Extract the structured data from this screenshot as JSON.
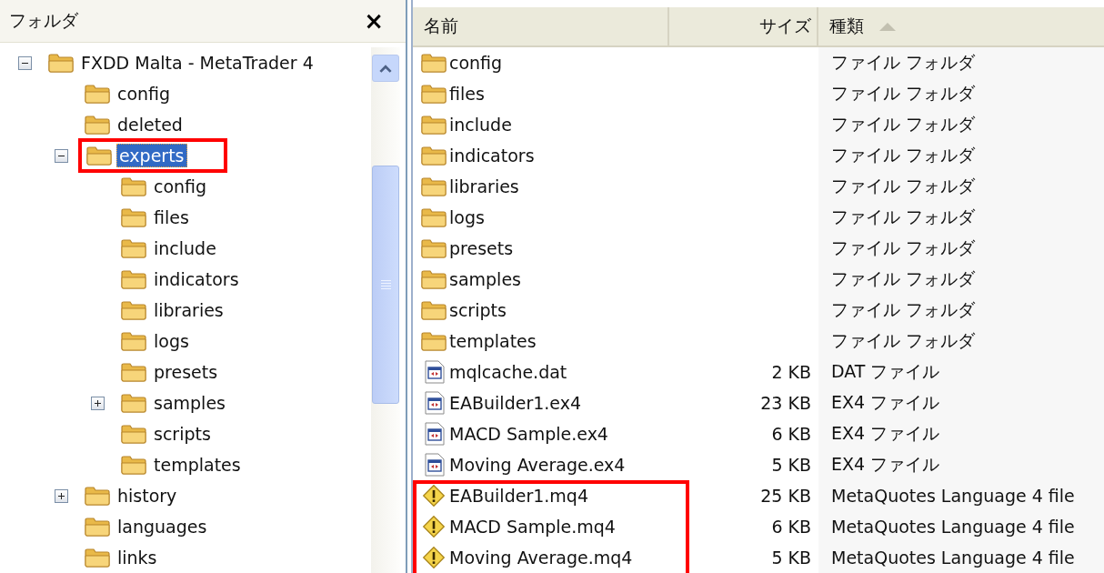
{
  "folder_pane": {
    "title": "フォルダ",
    "close": "×"
  },
  "tree": [
    {
      "label": "FXDD Malta - MetaTrader 4",
      "expanded": true,
      "selected": false,
      "children": [
        {
          "label": "config",
          "selected": false
        },
        {
          "label": "deleted",
          "selected": false
        },
        {
          "label": "experts",
          "expanded": true,
          "selected": true,
          "annotated": true,
          "children": [
            {
              "label": "config",
              "selected": false
            },
            {
              "label": "files",
              "selected": false
            },
            {
              "label": "include",
              "selected": false
            },
            {
              "label": "indicators",
              "selected": false
            },
            {
              "label": "libraries",
              "selected": false
            },
            {
              "label": "logs",
              "selected": false
            },
            {
              "label": "presets",
              "selected": false
            },
            {
              "label": "samples",
              "expanded": false,
              "selected": false
            },
            {
              "label": "scripts",
              "selected": false
            },
            {
              "label": "templates",
              "selected": false
            }
          ]
        },
        {
          "label": "history",
          "expanded": false,
          "selected": false
        },
        {
          "label": "languages",
          "selected": false
        },
        {
          "label": "links",
          "selected": false
        }
      ]
    }
  ],
  "file_list": {
    "columns": [
      {
        "label": "名前",
        "sorted": false
      },
      {
        "label": "サイズ",
        "sorted": false
      },
      {
        "label": "種類",
        "sorted": true
      }
    ],
    "rows": [
      {
        "kind": "folder",
        "name": "config",
        "type": "ファイル フォルダ"
      },
      {
        "kind": "folder",
        "name": "files",
        "type": "ファイル フォルダ"
      },
      {
        "kind": "folder",
        "name": "include",
        "type": "ファイル フォルダ"
      },
      {
        "kind": "folder",
        "name": "indicators",
        "type": "ファイル フォルダ"
      },
      {
        "kind": "folder",
        "name": "libraries",
        "type": "ファイル フォルダ"
      },
      {
        "kind": "folder",
        "name": "logs",
        "type": "ファイル フォルダ"
      },
      {
        "kind": "folder",
        "name": "presets",
        "type": "ファイル フォルダ"
      },
      {
        "kind": "folder",
        "name": "samples",
        "type": "ファイル フォルダ"
      },
      {
        "kind": "folder",
        "name": "scripts",
        "type": "ファイル フォルダ"
      },
      {
        "kind": "folder",
        "name": "templates",
        "type": "ファイル フォルダ"
      },
      {
        "kind": "program",
        "name": "mqlcache.dat",
        "size": "2 KB",
        "type": "DAT ファイル"
      },
      {
        "kind": "program",
        "name": "EABuilder1.ex4",
        "size": "23 KB",
        "type": "EX4 ファイル"
      },
      {
        "kind": "program",
        "name": "MACD Sample.ex4",
        "size": "6 KB",
        "type": "EX4 ファイル"
      },
      {
        "kind": "program",
        "name": "Moving Average.ex4",
        "size": "5 KB",
        "type": "EX4 ファイル"
      },
      {
        "kind": "warning",
        "name": "EABuilder1.mq4",
        "size": "25 KB",
        "type": "MetaQuotes Language 4 file",
        "annotated": true
      },
      {
        "kind": "warning",
        "name": "MACD Sample.mq4",
        "size": "6 KB",
        "type": "MetaQuotes Language 4 file",
        "annotated": true
      },
      {
        "kind": "warning",
        "name": "Moving Average.mq4",
        "size": "5 KB",
        "type": "MetaQuotes Language 4 file",
        "annotated": true
      }
    ]
  }
}
